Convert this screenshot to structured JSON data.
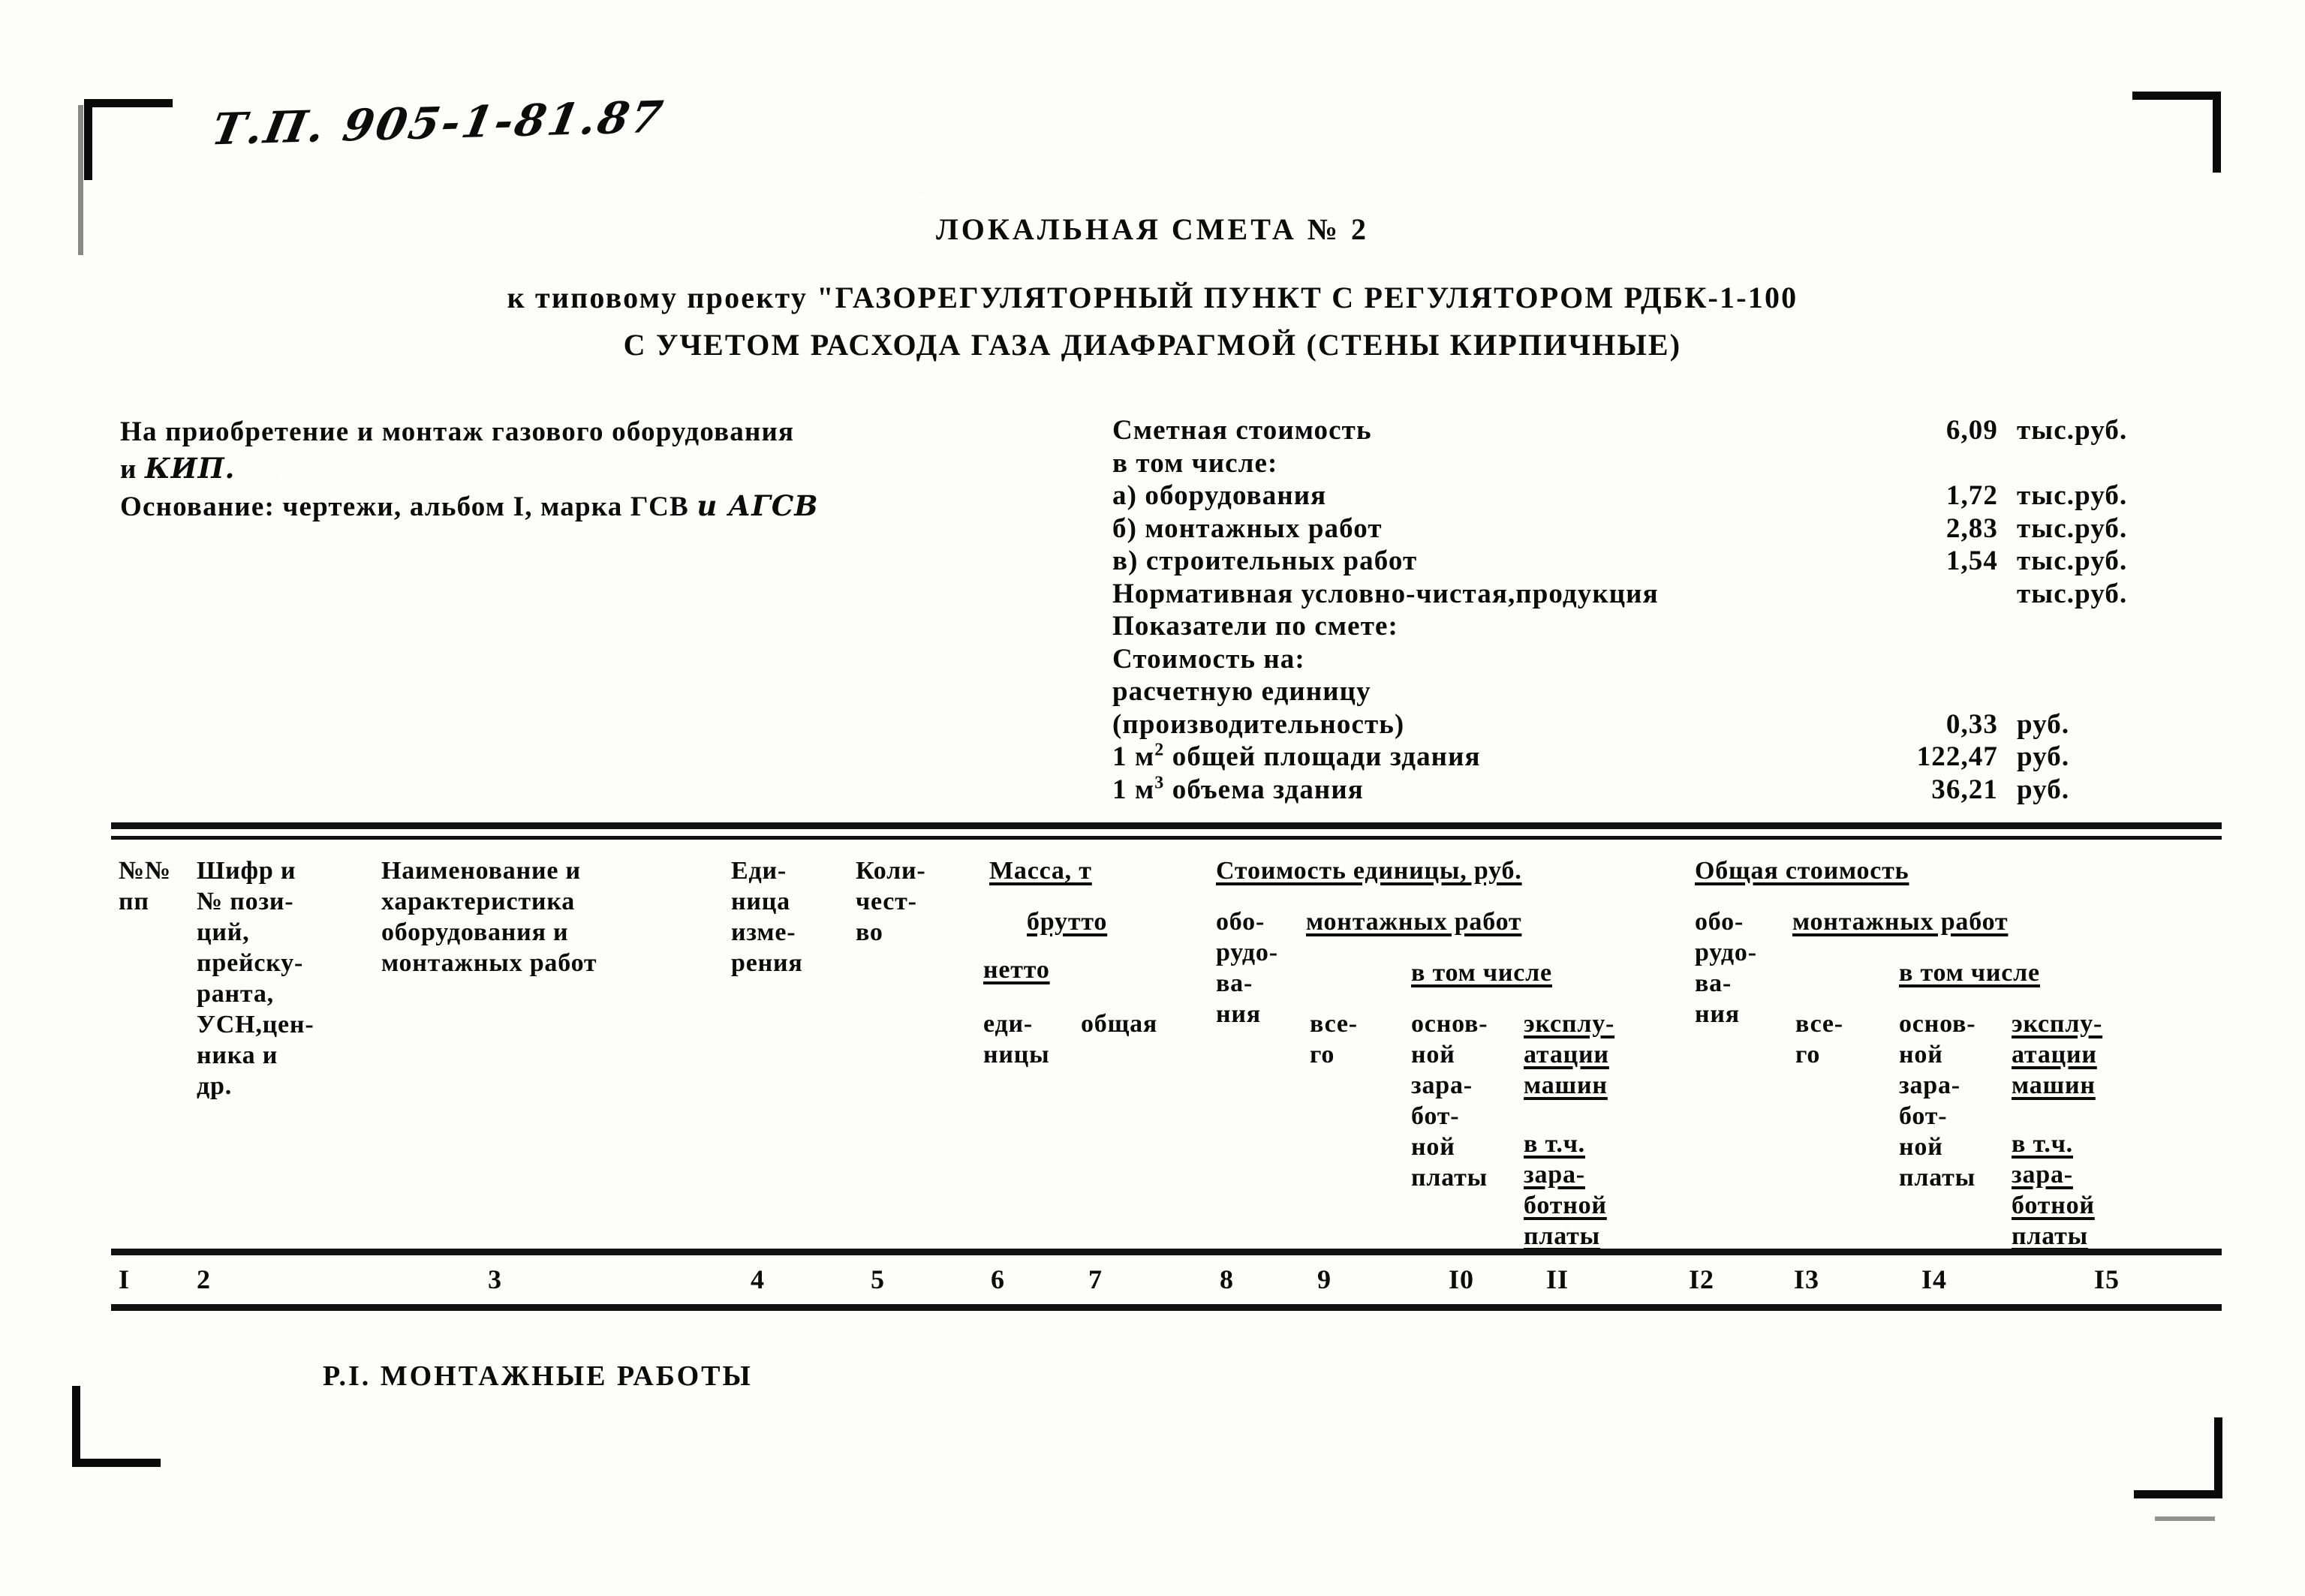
{
  "stamp": {
    "handwritten_code": "Т.П. 905-1-81.87"
  },
  "title": {
    "line1": "ЛОКАЛЬНАЯ СМЕТА № 2",
    "line2": "к типовому проекту \"ГАЗОРЕГУЛЯТОРНЫЙ ПУНКТ С РЕГУЛЯТОРОМ РДБК-1-100",
    "line3": "С УЧЕТОМ РАСХОДА ГАЗА ДИАФРАГМОЙ (СТЕНЫ КИРПИЧНЫЕ)"
  },
  "info_left": {
    "line1": "На приобретение и монтаж газового оборудования",
    "line2_prefix": "и ",
    "line2_ins": "КИП.",
    "line3_prefix": "Основание: чертежи, альбом I, марка ГСВ ",
    "line3_ins": "и АГСВ"
  },
  "summary": {
    "rows": [
      {
        "label": "Сметная стоимость",
        "value": "6,09",
        "unit": "тыс.руб."
      },
      {
        "label": "в том числе:",
        "value": "",
        "unit": ""
      },
      {
        "label": "а) оборудования",
        "value": "1,72",
        "unit": "тыс.руб."
      },
      {
        "label": "б) монтажных работ",
        "value": "2,83",
        "unit": "тыс.руб."
      },
      {
        "label": "в) строительных работ",
        "value": "1,54",
        "unit": "тыс.руб."
      },
      {
        "label": "Нормативная условно-чистая,продукция",
        "value": "",
        "unit": "тыс.руб."
      },
      {
        "label": "Показатели по смете:",
        "value": "",
        "unit": ""
      },
      {
        "label": "Стоимость на:",
        "value": "",
        "unit": ""
      },
      {
        "label": "расчетную единицу",
        "value": "",
        "unit": ""
      },
      {
        "label": "(производительность)",
        "value": "0,33",
        "unit": "руб."
      },
      {
        "label": "1 м2 общей площади здания",
        "value": "122,47",
        "unit": "руб."
      },
      {
        "label": "1 м3 объема здания",
        "value": "36,21",
        "unit": "руб."
      }
    ]
  },
  "table": {
    "headers": {
      "c1": "№№\nпп",
      "c2": "Шифр и\n№ пози-\nций,\nпрейску-\nранта,\nУСН,цен-\nника и\nдр.",
      "c3": "Наименование и\nхарактеристика\nоборудования и\nмонтажных работ",
      "c4": "Еди-\nница\nизме-\nрения",
      "c5": "Коли-\nчест-\nво",
      "masса_group": "Масса, т",
      "brutto": "брутто",
      "netto": "нетто",
      "c6": "еди-\nницы",
      "c7": "общая",
      "cost_unit_group": "Стоимость единицы, руб.",
      "c8": "обо-\nрудо-\nва-\nния",
      "montazh_unit": "монтажных работ",
      "c9": "все-\nго",
      "v_tom_chisle_unit": "в том числе",
      "c10": "основ-\nной\nзара-\nбот-\nной\nплаты",
      "c11_a": "эксплу-\nатации\nмашин",
      "c11_b": "в т.ч.\nзара-\nботной\nплаты",
      "total_group": "Общая стоимость",
      "c12": "обо-\nрудо-\nва-\nния",
      "montazh_total": "монтажных работ",
      "c13": "все-\nго",
      "v_tom_chisle_total": "в том числе",
      "c14": "основ-\nной\nзара-\nбот-\nной\nплаты",
      "c15_a": "эксплу-\nатации\nмашин",
      "c15_b": "в т.ч.\nзара-\nботной\nплаты"
    },
    "column_numbers": [
      "1",
      "2",
      "3",
      "4",
      "5",
      "6",
      "7",
      "8",
      "9",
      "10",
      "11",
      "12",
      "13",
      "14",
      "15"
    ]
  },
  "section": {
    "title": "Р.I. МОНТАЖНЫЕ РАБОТЫ"
  }
}
